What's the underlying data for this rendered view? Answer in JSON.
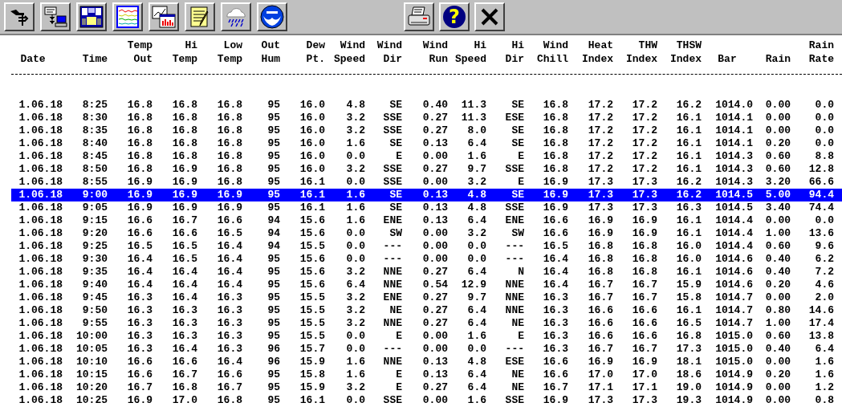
{
  "toolbar": {
    "left_buttons": [
      {
        "kind": "station"
      },
      {
        "kind": "download"
      },
      {
        "kind": "bulletin"
      },
      {
        "kind": "strip_chart"
      },
      {
        "kind": "graph"
      },
      {
        "kind": "notes"
      },
      {
        "kind": "rain"
      },
      {
        "kind": "globe"
      }
    ],
    "right_buttons": [
      {
        "kind": "print"
      },
      {
        "kind": "help",
        "label": "?"
      },
      {
        "kind": "close"
      }
    ]
  },
  "table": {
    "columns": [
      {
        "lines": [
          "Date"
        ]
      },
      {
        "lines": [
          "Time"
        ]
      },
      {
        "lines": [
          "Temp",
          "Out"
        ]
      },
      {
        "lines": [
          "Hi",
          "Temp"
        ]
      },
      {
        "lines": [
          "Low",
          "Temp"
        ]
      },
      {
        "lines": [
          "Out",
          "Hum"
        ]
      },
      {
        "lines": [
          "Dew",
          "Pt."
        ]
      },
      {
        "lines": [
          "Wind",
          "Speed"
        ]
      },
      {
        "lines": [
          "Wind",
          "Dir"
        ]
      },
      {
        "lines": [
          "Wind",
          "Run"
        ]
      },
      {
        "lines": [
          "Hi",
          "Speed"
        ]
      },
      {
        "lines": [
          "Hi",
          "Dir"
        ]
      },
      {
        "lines": [
          "Wind",
          "Chill"
        ]
      },
      {
        "lines": [
          "Heat",
          "Index"
        ]
      },
      {
        "lines": [
          "THW",
          "Index"
        ]
      },
      {
        "lines": [
          "THSW",
          "Index"
        ]
      },
      {
        "lines": [
          "Bar"
        ]
      },
      {
        "lines": [
          "Rain"
        ]
      },
      {
        "lines": [
          "Rain",
          "Rate"
        ]
      }
    ],
    "rows": [
      {
        "selected": false,
        "cells": [
          "1.06.18",
          "8:25",
          "16.8",
          "16.8",
          "16.8",
          "95",
          "16.0",
          "4.8",
          "SE",
          "0.40",
          "11.3",
          "SE",
          "16.8",
          "17.2",
          "17.2",
          "16.2",
          "1014.0",
          "0.00",
          "0.0"
        ]
      },
      {
        "selected": false,
        "cells": [
          "1.06.18",
          "8:30",
          "16.8",
          "16.8",
          "16.8",
          "95",
          "16.0",
          "3.2",
          "SSE",
          "0.27",
          "11.3",
          "ESE",
          "16.8",
          "17.2",
          "17.2",
          "16.1",
          "1014.1",
          "0.00",
          "0.0"
        ]
      },
      {
        "selected": false,
        "cells": [
          "1.06.18",
          "8:35",
          "16.8",
          "16.8",
          "16.8",
          "95",
          "16.0",
          "3.2",
          "SSE",
          "0.27",
          "8.0",
          "SE",
          "16.8",
          "17.2",
          "17.2",
          "16.1",
          "1014.1",
          "0.00",
          "0.0"
        ]
      },
      {
        "selected": false,
        "cells": [
          "1.06.18",
          "8:40",
          "16.8",
          "16.8",
          "16.8",
          "95",
          "16.0",
          "1.6",
          "SE",
          "0.13",
          "6.4",
          "SE",
          "16.8",
          "17.2",
          "17.2",
          "16.1",
          "1014.1",
          "0.20",
          "0.0"
        ]
      },
      {
        "selected": false,
        "cells": [
          "1.06.18",
          "8:45",
          "16.8",
          "16.8",
          "16.8",
          "95",
          "16.0",
          "0.0",
          "E",
          "0.00",
          "1.6",
          "E",
          "16.8",
          "17.2",
          "17.2",
          "16.1",
          "1014.3",
          "0.60",
          "8.8"
        ]
      },
      {
        "selected": false,
        "cells": [
          "1.06.18",
          "8:50",
          "16.8",
          "16.9",
          "16.8",
          "95",
          "16.0",
          "3.2",
          "SSE",
          "0.27",
          "9.7",
          "SSE",
          "16.8",
          "17.2",
          "17.2",
          "16.1",
          "1014.3",
          "0.60",
          "12.8"
        ]
      },
      {
        "selected": false,
        "cells": [
          "1.06.18",
          "8:55",
          "16.9",
          "16.9",
          "16.8",
          "95",
          "16.1",
          "0.0",
          "SSE",
          "0.00",
          "3.2",
          "E",
          "16.9",
          "17.3",
          "17.3",
          "16.2",
          "1014.3",
          "3.20",
          "66.6"
        ]
      },
      {
        "selected": true,
        "cells": [
          "1.06.18",
          "9:00",
          "16.9",
          "16.9",
          "16.9",
          "95",
          "16.1",
          "1.6",
          "SE",
          "0.13",
          "4.8",
          "SE",
          "16.9",
          "17.3",
          "17.3",
          "16.2",
          "1014.5",
          "5.00",
          "94.4"
        ]
      },
      {
        "selected": false,
        "cells": [
          "1.06.18",
          "9:05",
          "16.9",
          "16.9",
          "16.9",
          "95",
          "16.1",
          "1.6",
          "SE",
          "0.13",
          "4.8",
          "SSE",
          "16.9",
          "17.3",
          "17.3",
          "16.3",
          "1014.5",
          "3.40",
          "74.4"
        ]
      },
      {
        "selected": false,
        "cells": [
          "1.06.18",
          "9:15",
          "16.6",
          "16.7",
          "16.6",
          "94",
          "15.6",
          "1.6",
          "ENE",
          "0.13",
          "6.4",
          "ENE",
          "16.6",
          "16.9",
          "16.9",
          "16.1",
          "1014.4",
          "0.00",
          "0.0"
        ]
      },
      {
        "selected": false,
        "cells": [
          "1.06.18",
          "9:20",
          "16.6",
          "16.6",
          "16.5",
          "94",
          "15.6",
          "0.0",
          "SW",
          "0.00",
          "3.2",
          "SW",
          "16.6",
          "16.9",
          "16.9",
          "16.1",
          "1014.4",
          "1.00",
          "13.6"
        ]
      },
      {
        "selected": false,
        "cells": [
          "1.06.18",
          "9:25",
          "16.5",
          "16.5",
          "16.4",
          "94",
          "15.5",
          "0.0",
          "---",
          "0.00",
          "0.0",
          "---",
          "16.5",
          "16.8",
          "16.8",
          "16.0",
          "1014.4",
          "0.60",
          "9.6"
        ]
      },
      {
        "selected": false,
        "cells": [
          "1.06.18",
          "9:30",
          "16.4",
          "16.5",
          "16.4",
          "95",
          "15.6",
          "0.0",
          "---",
          "0.00",
          "0.0",
          "---",
          "16.4",
          "16.8",
          "16.8",
          "16.0",
          "1014.6",
          "0.40",
          "6.2"
        ]
      },
      {
        "selected": false,
        "cells": [
          "1.06.18",
          "9:35",
          "16.4",
          "16.4",
          "16.4",
          "95",
          "15.6",
          "3.2",
          "NNE",
          "0.27",
          "6.4",
          "N",
          "16.4",
          "16.8",
          "16.8",
          "16.1",
          "1014.6",
          "0.40",
          "7.2"
        ]
      },
      {
        "selected": false,
        "cells": [
          "1.06.18",
          "9:40",
          "16.4",
          "16.4",
          "16.4",
          "95",
          "15.6",
          "6.4",
          "NNE",
          "0.54",
          "12.9",
          "NNE",
          "16.4",
          "16.7",
          "16.7",
          "15.9",
          "1014.6",
          "0.20",
          "4.6"
        ]
      },
      {
        "selected": false,
        "cells": [
          "1.06.18",
          "9:45",
          "16.3",
          "16.4",
          "16.3",
          "95",
          "15.5",
          "3.2",
          "ENE",
          "0.27",
          "9.7",
          "NNE",
          "16.3",
          "16.7",
          "16.7",
          "15.8",
          "1014.7",
          "0.00",
          "2.0"
        ]
      },
      {
        "selected": false,
        "cells": [
          "1.06.18",
          "9:50",
          "16.3",
          "16.3",
          "16.3",
          "95",
          "15.5",
          "3.2",
          "NE",
          "0.27",
          "6.4",
          "NNE",
          "16.3",
          "16.6",
          "16.6",
          "16.1",
          "1014.7",
          "0.80",
          "14.6"
        ]
      },
      {
        "selected": false,
        "cells": [
          "1.06.18",
          "9:55",
          "16.3",
          "16.3",
          "16.3",
          "95",
          "15.5",
          "3.2",
          "NNE",
          "0.27",
          "6.4",
          "NE",
          "16.3",
          "16.6",
          "16.6",
          "16.5",
          "1014.7",
          "1.00",
          "17.4"
        ]
      },
      {
        "selected": false,
        "cells": [
          "1.06.18",
          "10:00",
          "16.3",
          "16.3",
          "16.3",
          "95",
          "15.5",
          "0.0",
          "E",
          "0.00",
          "1.6",
          "E",
          "16.3",
          "16.6",
          "16.6",
          "16.8",
          "1015.0",
          "0.60",
          "13.8"
        ]
      },
      {
        "selected": false,
        "cells": [
          "1.06.18",
          "10:05",
          "16.3",
          "16.4",
          "16.3",
          "96",
          "15.7",
          "0.0",
          "---",
          "0.00",
          "0.0",
          "---",
          "16.3",
          "16.7",
          "16.7",
          "17.3",
          "1015.0",
          "0.40",
          "6.4"
        ]
      },
      {
        "selected": false,
        "cells": [
          "1.06.18",
          "10:10",
          "16.6",
          "16.6",
          "16.4",
          "96",
          "15.9",
          "1.6",
          "NNE",
          "0.13",
          "4.8",
          "ESE",
          "16.6",
          "16.9",
          "16.9",
          "18.1",
          "1015.0",
          "0.00",
          "1.6"
        ]
      },
      {
        "selected": false,
        "cells": [
          "1.06.18",
          "10:15",
          "16.6",
          "16.7",
          "16.6",
          "95",
          "15.8",
          "1.6",
          "E",
          "0.13",
          "6.4",
          "NE",
          "16.6",
          "17.0",
          "17.0",
          "18.6",
          "1014.9",
          "0.20",
          "1.6"
        ]
      },
      {
        "selected": false,
        "cells": [
          "1.06.18",
          "10:20",
          "16.7",
          "16.8",
          "16.7",
          "95",
          "15.9",
          "3.2",
          "E",
          "0.27",
          "6.4",
          "NE",
          "16.7",
          "17.1",
          "17.1",
          "19.0",
          "1014.9",
          "0.00",
          "1.2"
        ]
      },
      {
        "selected": false,
        "cells": [
          "1.06.18",
          "10:25",
          "16.9",
          "17.0",
          "16.8",
          "95",
          "16.1",
          "0.0",
          "SSE",
          "0.00",
          "1.6",
          "SSE",
          "16.9",
          "17.3",
          "17.3",
          "19.3",
          "1014.9",
          "0.00",
          "0.8"
        ]
      }
    ]
  }
}
